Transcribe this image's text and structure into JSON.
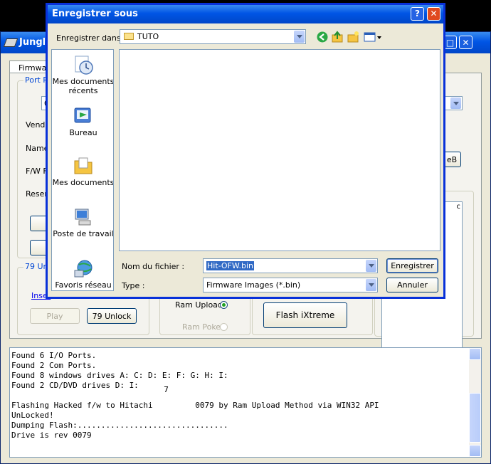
{
  "main_window": {
    "title": "Jungle",
    "tab_label": "Firmware",
    "group_port_label": "Port P",
    "field_vendor": "Vendo",
    "field_name": "Name:",
    "field_fw": "F/W F",
    "field_reserved": "Reser",
    "combo_left_value": "0",
    "group_unlock_label": "79 Unlo",
    "insert_link": "Inser",
    "play_button": "Play",
    "unlock_button": "79 Unlock",
    "ram_upload_label": "Ram Upload",
    "ram_poke_label": "Ram Poke",
    "flash_button": "Flash iXtreme",
    "right_button": "eB",
    "right_list_text": "c"
  },
  "log": {
    "lines": [
      "Found 6 I/O Ports.",
      "Found 2 Com Ports.",
      "Found 8 windows drives A: C: D: E: F: G: H: I:",
      "Found 2 CD/DVD drives D: I:",
      "Flashing Hacked f/w to Hitachi         0079 by Ram Upload Method via WIN32 API",
      "UnLocked!",
      "Dumping Flash:................................",
      "Drive is rev 0079"
    ],
    "overlay_number": "7"
  },
  "dialog": {
    "title": "Enregistrer sous",
    "save_in_label": "Enregistrer dans :",
    "save_in_value": "TUTO",
    "places": [
      {
        "label": "Mes documents récents",
        "icon": "recent-documents-icon"
      },
      {
        "label": "Bureau",
        "icon": "desktop-icon"
      },
      {
        "label": "Mes documents",
        "icon": "my-documents-icon"
      },
      {
        "label": "Poste de travail",
        "icon": "my-computer-icon"
      },
      {
        "label": "Favoris réseau",
        "icon": "network-places-icon"
      }
    ],
    "filename_label": "Nom du fichier :",
    "filename_value": "Hit-OFW.bin",
    "type_label": "Type :",
    "type_value": "Firmware Images (*.bin)",
    "save_button": "Enregistrer",
    "cancel_button": "Annuler",
    "help_glyph": "?",
    "close_glyph": "✕"
  }
}
